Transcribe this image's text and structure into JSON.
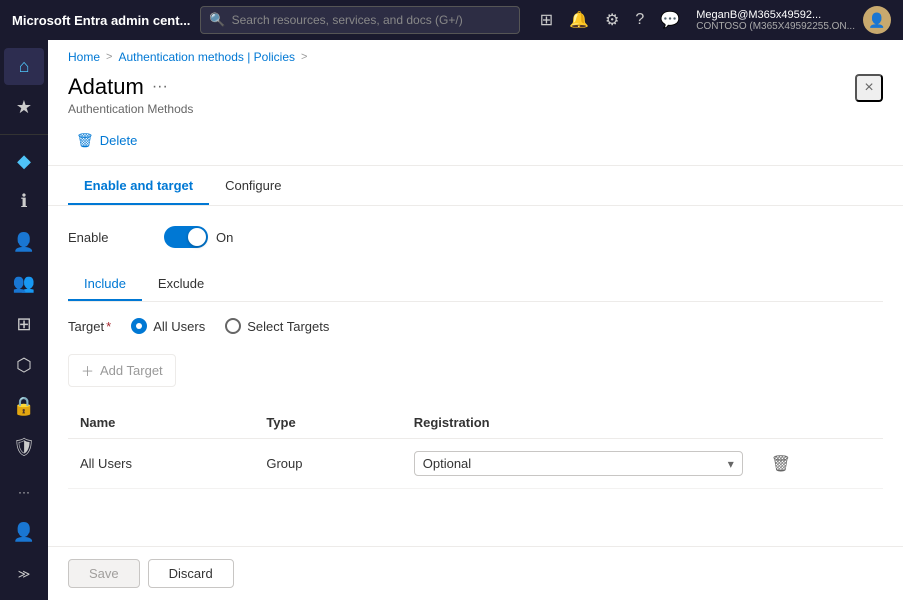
{
  "topbar": {
    "title": "Microsoft Entra admin cent...",
    "search_placeholder": "Search resources, services, and docs (G+/)",
    "user_name": "MeganB@M365x49592...",
    "user_tenant": "CONTOSO (M365X49592255.ON..."
  },
  "sidebar": {
    "items": [
      {
        "id": "home",
        "icon": "⌂",
        "label": "Home"
      },
      {
        "id": "favorites",
        "icon": "★",
        "label": "Favorites"
      },
      {
        "id": "separator1",
        "icon": "",
        "label": ""
      },
      {
        "id": "identity",
        "icon": "◆",
        "label": "Identity"
      },
      {
        "id": "info",
        "icon": "ℹ",
        "label": "Info"
      },
      {
        "id": "users",
        "icon": "👤",
        "label": "Users"
      },
      {
        "id": "groups",
        "icon": "👥",
        "label": "Groups"
      },
      {
        "id": "apps",
        "icon": "⊞",
        "label": "Apps"
      },
      {
        "id": "network",
        "icon": "⬡",
        "label": "Network"
      },
      {
        "id": "lock",
        "icon": "🔒",
        "label": "Lock"
      },
      {
        "id": "security",
        "icon": "🛡",
        "label": "Security"
      },
      {
        "id": "more",
        "icon": "···",
        "label": "More"
      },
      {
        "id": "profile",
        "icon": "👤",
        "label": "Profile"
      },
      {
        "id": "expand",
        "icon": "≫",
        "label": "Expand"
      }
    ]
  },
  "breadcrumb": {
    "home": "Home",
    "separator1": ">",
    "auth_methods": "Authentication methods | Policies",
    "separator2": ">"
  },
  "panel": {
    "title": "Adatum",
    "more_label": "···",
    "subtitle": "Authentication Methods",
    "close_label": "×"
  },
  "toolbar": {
    "delete_label": "Delete"
  },
  "tabs": [
    {
      "id": "enable-target",
      "label": "Enable and target"
    },
    {
      "id": "configure",
      "label": "Configure"
    }
  ],
  "enable_section": {
    "label": "Enable",
    "toggle_state": "On"
  },
  "sub_tabs": [
    {
      "id": "include",
      "label": "Include"
    },
    {
      "id": "exclude",
      "label": "Exclude"
    }
  ],
  "target_section": {
    "label": "Target",
    "required": "*",
    "options": [
      {
        "id": "all-users",
        "label": "All Users",
        "selected": true
      },
      {
        "id": "select-targets",
        "label": "Select Targets",
        "selected": false
      }
    ]
  },
  "add_target": {
    "label": "Add Target"
  },
  "table": {
    "columns": [
      {
        "id": "name",
        "label": "Name"
      },
      {
        "id": "type",
        "label": "Type"
      },
      {
        "id": "registration",
        "label": "Registration"
      }
    ],
    "rows": [
      {
        "name": "All Users",
        "type": "Group",
        "registration": "Optional"
      }
    ]
  },
  "footer": {
    "save_label": "Save",
    "discard_label": "Discard"
  }
}
